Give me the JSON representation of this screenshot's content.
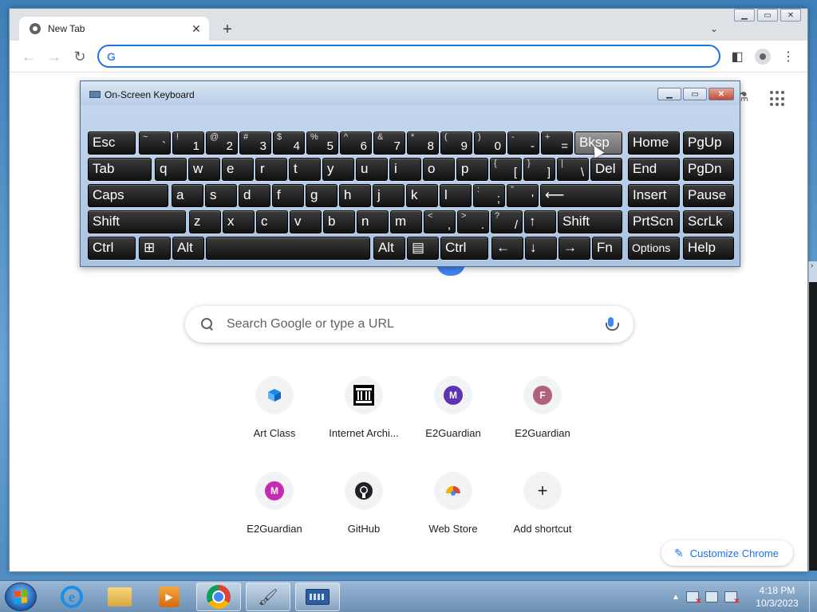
{
  "browser": {
    "tab_title": "New Tab",
    "omnibox_value": "",
    "search_placeholder": "Search Google or type a URL",
    "customize_label": "Customize Chrome",
    "shortcuts": [
      {
        "label": "Art Class",
        "icon": "art-class-favicon"
      },
      {
        "label": "Internet Archi...",
        "icon": "internet-archive-icon"
      },
      {
        "label": "E2Guardian",
        "letter": "M",
        "color": "#5e35b1"
      },
      {
        "label": "E2Guardian",
        "letter": "F",
        "color": "#b0607a"
      },
      {
        "label": "E2Guardian",
        "letter": "M",
        "color": "#c52bb0"
      },
      {
        "label": "GitHub",
        "icon": "github-icon"
      },
      {
        "label": "Web Store",
        "icon": "web-store-icon"
      },
      {
        "label": "Add shortcut",
        "icon": "plus-icon"
      }
    ]
  },
  "osk": {
    "title": "On-Screen Keyboard",
    "rows": [
      [
        {
          "m": "Esc"
        },
        {
          "s": "~",
          "l": "`"
        },
        {
          "s": "!",
          "l": "1"
        },
        {
          "s": "@",
          "l": "2"
        },
        {
          "s": "#",
          "l": "3"
        },
        {
          "s": "$",
          "l": "4"
        },
        {
          "s": "%",
          "l": "5"
        },
        {
          "s": "^",
          "l": "6"
        },
        {
          "s": "&",
          "l": "7"
        },
        {
          "s": "*",
          "l": "8"
        },
        {
          "s": "(",
          "l": "9"
        },
        {
          "s": ")",
          "l": "0"
        },
        {
          "s": "-",
          "l": "-"
        },
        {
          "s": "+",
          "l": "="
        },
        {
          "m": "Bksp",
          "hl": true
        },
        {
          "m": "Home"
        },
        {
          "m": "PgUp"
        }
      ],
      [
        {
          "m": "Tab"
        },
        {
          "m": "q"
        },
        {
          "m": "w"
        },
        {
          "m": "e"
        },
        {
          "m": "r"
        },
        {
          "m": "t"
        },
        {
          "m": "y"
        },
        {
          "m": "u"
        },
        {
          "m": "i"
        },
        {
          "m": "o"
        },
        {
          "m": "p"
        },
        {
          "s": "{",
          "l": "["
        },
        {
          "s": "}",
          "l": "]"
        },
        {
          "s": "|",
          "l": "\\"
        },
        {
          "m": "Del"
        },
        {
          "m": "End"
        },
        {
          "m": "PgDn"
        }
      ],
      [
        {
          "m": "Caps"
        },
        {
          "m": "a"
        },
        {
          "m": "s"
        },
        {
          "m": "d"
        },
        {
          "m": "f"
        },
        {
          "m": "g"
        },
        {
          "m": "h"
        },
        {
          "m": "j"
        },
        {
          "m": "k"
        },
        {
          "m": "l"
        },
        {
          "s": ":",
          "l": ";"
        },
        {
          "s": "\"",
          "l": "'"
        },
        {
          "m": "⟵"
        },
        {
          "m": "Insert"
        },
        {
          "m": "Pause"
        }
      ],
      [
        {
          "m": "Shift"
        },
        {
          "m": "z"
        },
        {
          "m": "x"
        },
        {
          "m": "c"
        },
        {
          "m": "v"
        },
        {
          "m": "b"
        },
        {
          "m": "n"
        },
        {
          "m": "m"
        },
        {
          "s": "<",
          "l": ","
        },
        {
          "s": ">",
          "l": "."
        },
        {
          "s": "?",
          "l": "/"
        },
        {
          "m": "↑"
        },
        {
          "m": "Shift"
        },
        {
          "m": "PrtScn"
        },
        {
          "m": "ScrLk"
        }
      ],
      [
        {
          "m": "Ctrl"
        },
        {
          "m": "⊞"
        },
        {
          "m": "Alt"
        },
        {
          "m": ""
        },
        {
          "m": "Alt"
        },
        {
          "m": "▤"
        },
        {
          "m": "Ctrl"
        },
        {
          "m": "←"
        },
        {
          "m": "↓"
        },
        {
          "m": "→"
        },
        {
          "m": "Fn"
        },
        {
          "m": "Options",
          "small": true
        },
        {
          "m": "Help"
        }
      ]
    ]
  },
  "taskbar": {
    "time": "4:18 PM",
    "date": "10/3/2023"
  }
}
